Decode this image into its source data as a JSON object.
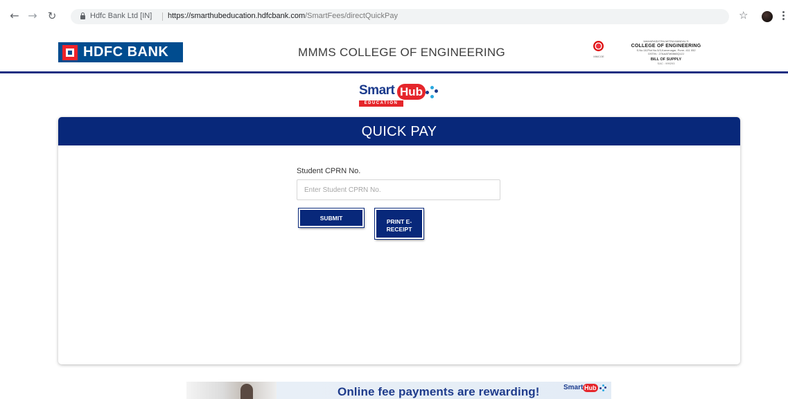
{
  "browser": {
    "site_identity": "Hdfc Bank Ltd [IN]",
    "url_base": "https://smarthubeducation.hdfcbank.com",
    "url_path": "/SmartFees/directQuickPay",
    "back_icon": "arrow-left-icon",
    "forward_icon": "arrow-right-icon",
    "reload_icon": "reload-icon",
    "star_icon": "star-icon",
    "menu_icon": "kebab-menu-icon"
  },
  "header": {
    "bank_logo_text": "HDFC BANK",
    "college_name": "MMMS COLLEGE OF ENGINEERING",
    "college_block": {
      "line1": "MAHARASHTRA MITRA MANDAL'S",
      "line2": "COLLEGE OF ENGINEERING",
      "line3": "S.No.18,Plot No.5/3,Karvenagar, Pune- 411 052",
      "line4": "GSTIN : 27AAATM0860Q1ZJ",
      "line5": "BILL OF SUPPLY",
      "line6": "SAC : 999293"
    },
    "emblem_caption": "MMCOE",
    "accent_color": "#1c2f82"
  },
  "smarthub_logo": {
    "smart": "Smart",
    "hub": "Hub",
    "tagline": "EDUCATION"
  },
  "quick_pay": {
    "title": "QUICK PAY",
    "field_label": "Student CPRN No.",
    "input_placeholder": "Enter Student CPRN No.",
    "input_value": "",
    "submit_label": "SUBMIT",
    "print_label": "PRINT E-RECEIPT",
    "primary_color": "#08287a"
  },
  "banner": {
    "text": "Online fee payments are rewarding!",
    "logo_smart": "Smart",
    "logo_hub": "Hub"
  }
}
